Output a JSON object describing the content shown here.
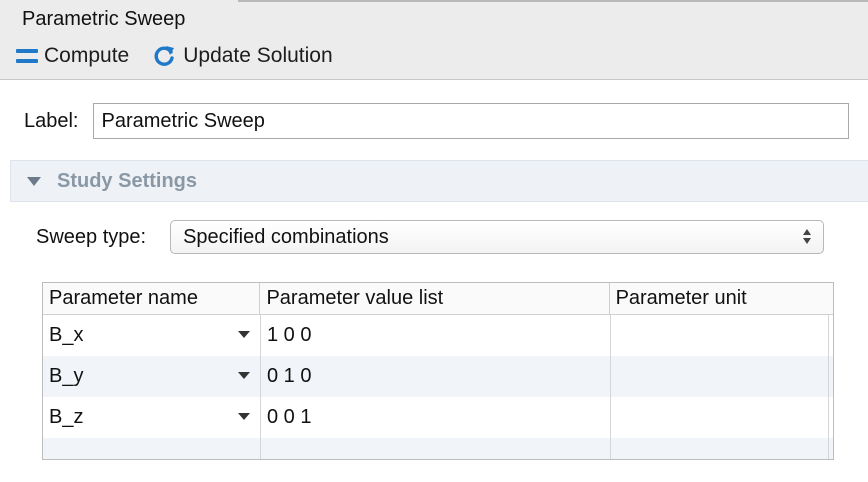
{
  "window": {
    "title": "Parametric Sweep"
  },
  "toolbar": {
    "compute_label": "Compute",
    "update_label": "Update Solution",
    "compute_icon": "compute-icon",
    "update_icon": "refresh-icon",
    "accent_color": "#1f78c8"
  },
  "label_field": {
    "label": "Label:",
    "value": "Parametric Sweep"
  },
  "study_settings": {
    "title": "Study Settings",
    "sweep_type": {
      "label": "Sweep type:",
      "selected": "Specified combinations"
    },
    "table": {
      "headers": [
        "Parameter name",
        "Parameter value list",
        "Parameter unit"
      ],
      "rows": [
        {
          "name": "B_x",
          "values": "1 0 0",
          "unit": ""
        },
        {
          "name": "B_y",
          "values": "0 1 0",
          "unit": ""
        },
        {
          "name": "B_z",
          "values": "0 0 1",
          "unit": ""
        }
      ]
    }
  }
}
